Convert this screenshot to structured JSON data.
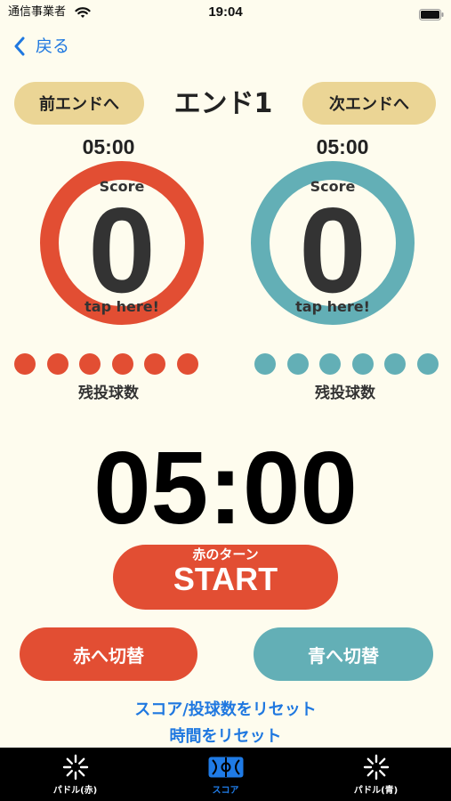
{
  "status_bar": {
    "carrier": "通信事業者",
    "time": "19:04",
    "wifi_icon": "wifi-icon",
    "battery_icon": "battery-icon"
  },
  "nav": {
    "back_label": "戻る",
    "back_icon": "chevron-left-icon"
  },
  "end_nav": {
    "prev_label": "前エンドへ",
    "title": "エンド1",
    "next_label": "次エンドへ"
  },
  "players": [
    {
      "color": "#E24E33",
      "timer": "05:00",
      "score_label": "Score",
      "score": "0",
      "tap_hint": "tap here!",
      "balls_remaining": 6,
      "balls_label": "残投球数"
    },
    {
      "color": "#63AFB6",
      "timer": "05:00",
      "score_label": "Score",
      "score": "0",
      "tap_hint": "tap here!",
      "balls_remaining": 6,
      "balls_label": "残投球数"
    }
  ],
  "main_timer": "05:00",
  "start_button": {
    "turn_label": "赤のターン",
    "label": "START"
  },
  "switch_buttons": {
    "to_red_label": "赤へ切替",
    "to_blue_label": "青へ切替"
  },
  "reset_links": {
    "score_reset_label": "スコア/投球数をリセット",
    "time_reset_label": "時間をリセット"
  },
  "tab_bar": {
    "items": [
      {
        "label": "パドル(赤)",
        "icon": "spinner-icon",
        "selected": false
      },
      {
        "label": "スコア",
        "icon": "court-icon",
        "selected": true
      },
      {
        "label": "パドル(青)",
        "icon": "spinner-icon",
        "selected": false
      }
    ]
  },
  "colors": {
    "red": "#E24E33",
    "teal": "#63AFB6",
    "tan": "#EBD595",
    "link": "#1F78E0",
    "background": "#FEFCEE",
    "text": "#333333",
    "tab_bar": "#000000",
    "tab_active": "#1F7BE6"
  }
}
